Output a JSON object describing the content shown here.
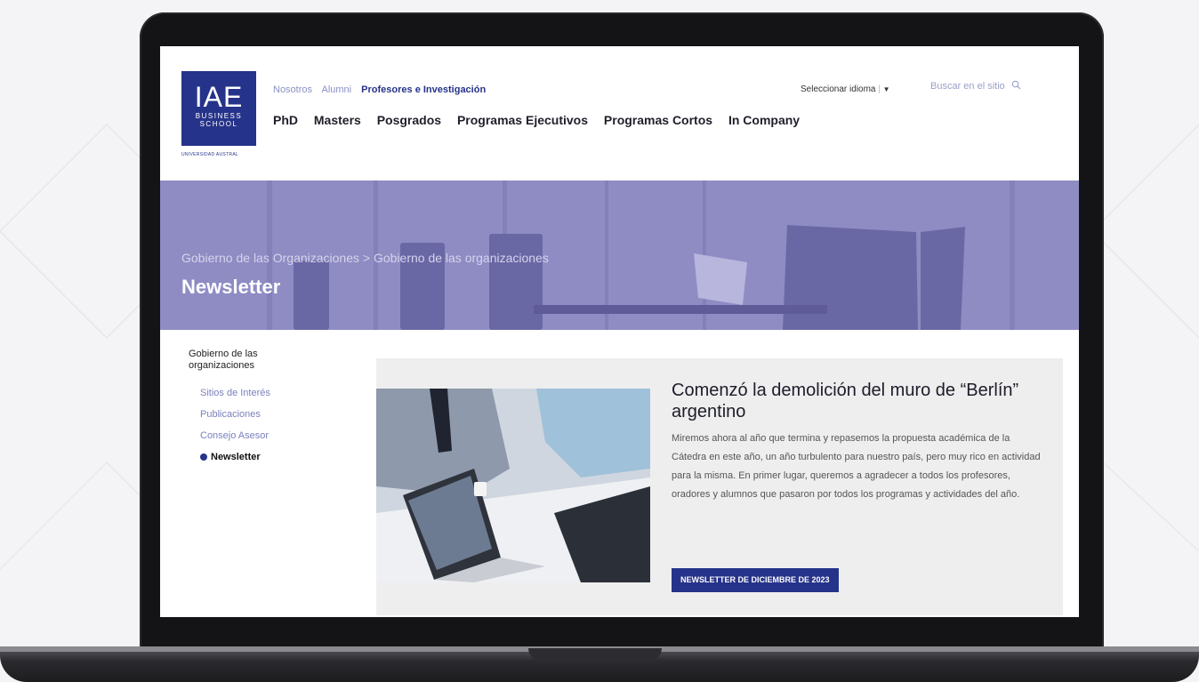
{
  "header": {
    "logo": {
      "main": "IAE",
      "line1": "BUSINESS",
      "line2": "SCHOOL",
      "sub": "UNIVERSIDAD AUSTRAL"
    },
    "top_nav": [
      "Nosotros",
      "Alumni",
      "Profesores e Investigación"
    ],
    "main_nav": [
      "PhD",
      "Masters",
      "Posgrados",
      "Programas Ejecutivos",
      "Programas Cortos",
      "In Company"
    ],
    "language": {
      "label": "Seleccionar idioma",
      "arrow": "▼"
    },
    "search": {
      "placeholder": "Buscar en el sitio",
      "icon": "search-icon"
    }
  },
  "hero": {
    "breadcrumb": "Gobierno de las Organizaciones > Gobierno de las organizaciones",
    "title": "Newsletter"
  },
  "sidebar": {
    "title": "Gobierno de las organizaciones",
    "items": [
      "Sitios de Interés",
      "Publicaciones",
      "Consejo Asesor"
    ],
    "active": "Newsletter"
  },
  "card": {
    "title": "Comenzó la demolición del muro de “Berlín” argentino",
    "body": "Miremos ahora al año que termina y repasemos la propuesta académica de la Cátedra en este año, un año turbulento para nuestro país, pero muy rico en actividad para la misma. En primer lugar, queremos a agradecer a todos los profesores, oradores y alumnos que pasaron por todos los programas y actividades del año.",
    "button": "NEWSLETTER DE DICIEMBRE DE 2023"
  },
  "colors": {
    "brand": "#26338a",
    "hero": "#8f8cc4",
    "card_bg": "#eeeeee"
  }
}
